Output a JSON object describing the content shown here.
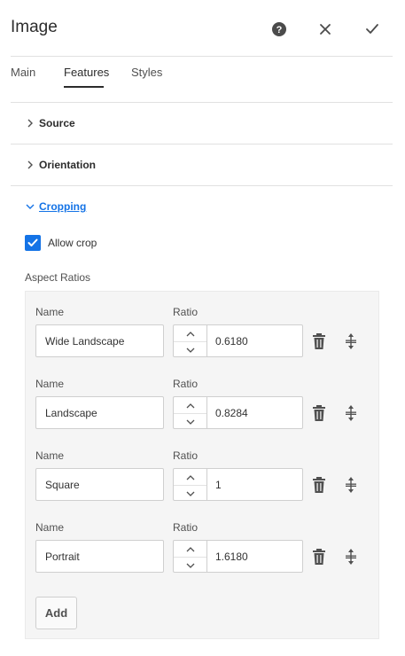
{
  "dialog": {
    "title": "Image"
  },
  "header_actions": {
    "help": "help-icon",
    "close": "close-icon",
    "done": "checkmark-icon"
  },
  "tabs": [
    {
      "label": "Main",
      "active": false
    },
    {
      "label": "Features",
      "active": true
    },
    {
      "label": "Styles",
      "active": false
    }
  ],
  "sections": [
    {
      "label": "Source",
      "expanded": false
    },
    {
      "label": "Orientation",
      "expanded": false
    },
    {
      "label": "Cropping",
      "expanded": true
    }
  ],
  "cropping": {
    "allow_crop": {
      "label": "Allow crop",
      "checked": true
    },
    "aspect_ratios_label": "Aspect Ratios",
    "name_label": "Name",
    "ratio_label": "Ratio",
    "items": [
      {
        "name": "Wide Landscape",
        "ratio": "0.6180"
      },
      {
        "name": "Landscape",
        "ratio": "0.8284"
      },
      {
        "name": "Square",
        "ratio": "1"
      },
      {
        "name": "Portrait",
        "ratio": "1.6180"
      }
    ],
    "add_label": "Add"
  },
  "colors": {
    "accent": "#1473e6",
    "text": "#323232",
    "panel": "#f5f5f5",
    "divider": "#e1e1e1"
  }
}
